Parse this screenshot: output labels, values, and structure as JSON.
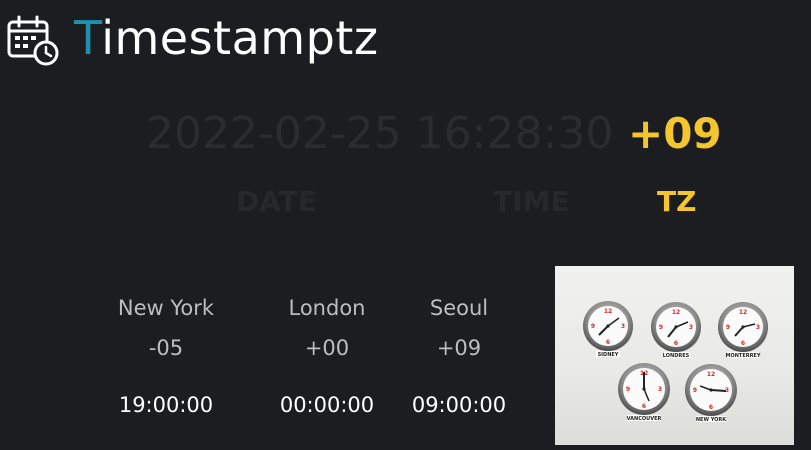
{
  "app": {
    "title_first_letter": "T",
    "title_rest": "imestamptz"
  },
  "timestamp": {
    "datetime": "2022-02-25 16:28:30",
    "tz": "+09"
  },
  "labels": {
    "date": "DATE",
    "time": "TIME",
    "tz": "TZ"
  },
  "cities": [
    {
      "name": "New York",
      "offset": "-05",
      "time": "19:00:00"
    },
    {
      "name": "London",
      "offset": "+00",
      "time": "00:00:00"
    },
    {
      "name": "Seoul",
      "offset": "+09",
      "time": "09:00:00"
    }
  ],
  "photo": {
    "clocks": [
      {
        "caption": "SIDNEY"
      },
      {
        "caption": "LONDRES"
      },
      {
        "caption": "MONTERREY"
      },
      {
        "caption": "VANCOUVER"
      },
      {
        "caption": "NEW YORK"
      }
    ]
  },
  "colors": {
    "background": "#1c1d20",
    "accent_blue": "#1f8fb0",
    "accent_yellow": "#f4c52d",
    "dim_text": "#2b2c30"
  },
  "icons": {
    "logo": "calendar-clock-icon"
  }
}
